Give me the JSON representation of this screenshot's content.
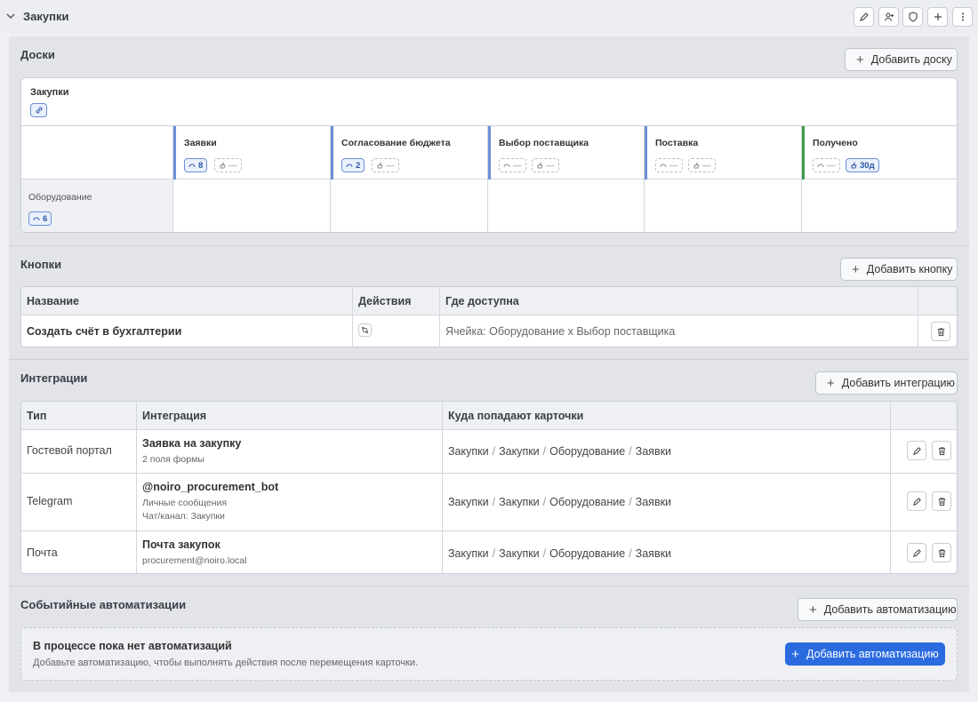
{
  "header": {
    "title": "Закупки"
  },
  "colors": {
    "accent": "#2b6be0",
    "stage_bar": "#6b8fd6",
    "stage_done": "#3f9c4b"
  },
  "boards": {
    "title": "Доски",
    "add_label": "Добавить доску",
    "board": {
      "name": "Закупки",
      "columns": [
        {
          "name": "Заявки",
          "count": "8",
          "limit": "—"
        },
        {
          "name": "Согласование бюджета",
          "count": "2",
          "limit": "—"
        },
        {
          "name": "Выбор поставщика",
          "count": "—",
          "limit": "—"
        },
        {
          "name": "Поставка",
          "count": "—",
          "limit": "—"
        },
        {
          "name": "Получено",
          "count": "—",
          "limit": "30д"
        }
      ],
      "rows": [
        {
          "name": "Оборудование",
          "count": "6"
        }
      ]
    }
  },
  "buttons": {
    "title": "Кнопки",
    "add_label": "Добавить кнопку",
    "headers": {
      "name": "Название",
      "actions": "Действия",
      "where": "Где доступна"
    },
    "rows": [
      {
        "name": "Создать счёт в бухгалтерии",
        "where": "Ячейка: Оборудование x Выбор поставщика"
      }
    ]
  },
  "integrations": {
    "title": "Интеграции",
    "add_label": "Добавить интеграцию",
    "headers": {
      "type": "Тип",
      "integration": "Интеграция",
      "destination": "Куда попадают карточки"
    },
    "rows": [
      {
        "type": "Гостевой портал",
        "name": "Заявка на закупку",
        "line1": "2 поля формы",
        "line2": "",
        "path": [
          "Закупки",
          "Закупки",
          "Оборудование",
          "Заявки"
        ]
      },
      {
        "type": "Telegram",
        "name": "@noiro_procurement_bot",
        "line1": "Личные сообщения",
        "line2": "Чат/канал: Закупки",
        "path": [
          "Закупки",
          "Закупки",
          "Оборудование",
          "Заявки"
        ]
      },
      {
        "type": "Почта",
        "name": "Почта закупок",
        "line1": "procurement@noiro.local",
        "line2": "",
        "path": [
          "Закупки",
          "Закупки",
          "Оборудование",
          "Заявки"
        ]
      }
    ]
  },
  "automations": {
    "title": "Событийные автоматизации",
    "add_label": "Добавить автоматизацию",
    "empty_title": "В процессе пока нет автоматизаций",
    "empty_text": "Добавьте автоматизацию, чтобы выполнять действия после перемещения карточки.",
    "primary_label": "Добавить автоматизацию"
  }
}
